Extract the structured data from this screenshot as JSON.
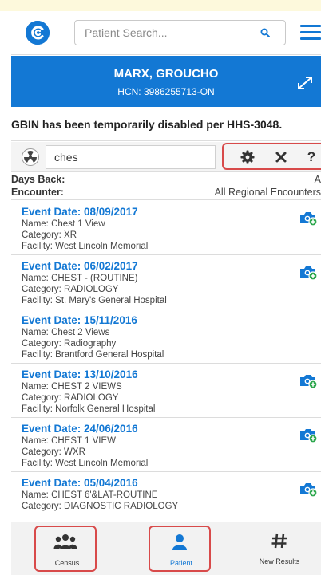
{
  "header": {
    "search_placeholder": "Patient Search..."
  },
  "patient": {
    "name": "MARX, GROUCHO",
    "hcn": "HCN: 3986255713-ON"
  },
  "notice": "GBIN has been temporarily disabled per HHS-3048.",
  "filter": {
    "value": "ches"
  },
  "meta": {
    "days_back_label": "Days Back:",
    "days_back_value": "A",
    "encounter_label": "Encounter:",
    "encounter_value": "All Regional Encounters"
  },
  "events": [
    {
      "date": "Event Date: 08/09/2017",
      "name": "Name: Chest 1 View",
      "category": "Category: XR",
      "facility": "Facility: West Lincoln Memorial",
      "has_image": true
    },
    {
      "date": "Event Date: 06/02/2017",
      "name": "Name: CHEST - (ROUTINE)",
      "category": "Category: RADIOLOGY",
      "facility": "Facility: St. Mary's General Hospital",
      "has_image": true
    },
    {
      "date": "Event Date: 15/11/2016",
      "name": "Name: Chest 2 Views",
      "category": "Category: Radiography",
      "facility": "Facility: Brantford General Hospital",
      "has_image": false
    },
    {
      "date": "Event Date: 13/10/2016",
      "name": "Name: CHEST 2 VIEWS",
      "category": "Category: RADIOLOGY",
      "facility": "Facility: Norfolk General Hospital",
      "has_image": true
    },
    {
      "date": "Event Date: 24/06/2016",
      "name": "Name: CHEST 1 VIEW",
      "category": "Category: WXR",
      "facility": "Facility: West Lincoln Memorial",
      "has_image": true
    },
    {
      "date": "Event Date: 05/04/2016",
      "name": "Name: CHEST 6'&LAT-ROUTINE",
      "category": "Category: DIAGNOSTIC RADIOLOGY",
      "facility": "",
      "has_image": true
    }
  ],
  "nav": {
    "census": "Census",
    "patient": "Patient",
    "new_results": "New Results"
  },
  "icons": {
    "logo": "logo-icon",
    "search": "search-icon",
    "menu": "hamburger-menu-icon",
    "expand": "expand-arrows-icon",
    "filter": "radiation-icon",
    "settings": "gear-icon",
    "clear": "close-icon",
    "help": "help-icon",
    "image": "camera-plus-icon",
    "census": "users-icon",
    "patient": "user-icon",
    "results": "hashtag-icon"
  },
  "colors": {
    "brand": "#1378d4",
    "highlight": "#d84a4a",
    "camera_badge": "#2fa84f"
  }
}
